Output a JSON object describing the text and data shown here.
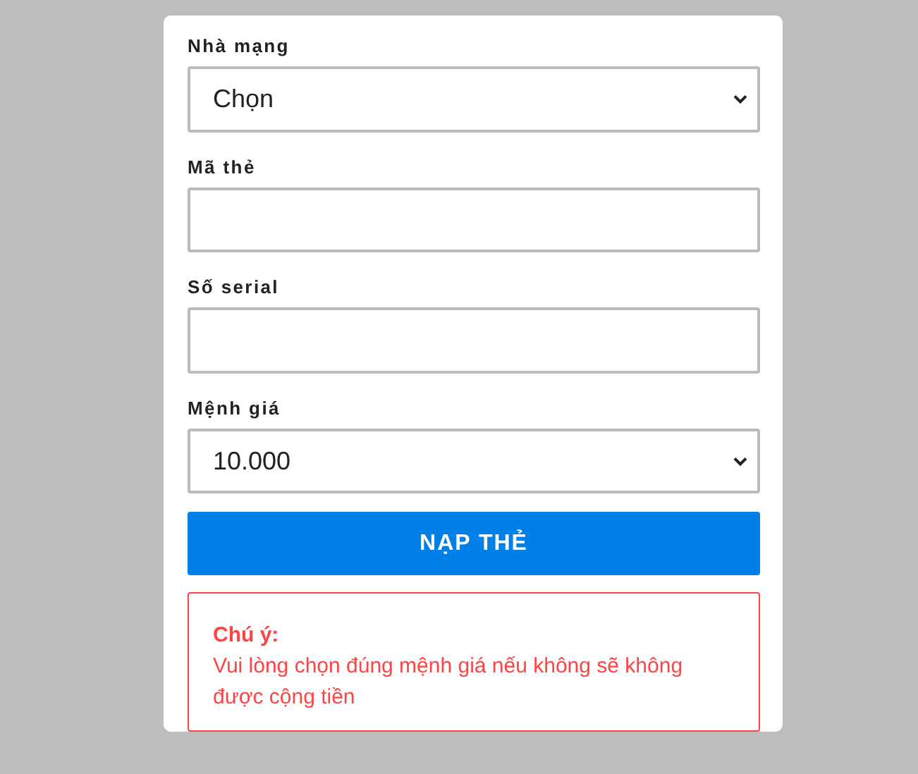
{
  "fields": [
    {
      "label": "Nhà mạng",
      "kind": "select",
      "value": "Chọn"
    },
    {
      "label": "Mã thẻ",
      "kind": "text"
    },
    {
      "label": "Số serial",
      "kind": "text"
    },
    {
      "label": "Mệnh giá",
      "kind": "select",
      "value": "10.000"
    }
  ],
  "submit_button": "NẠP THẺ",
  "notice": {
    "title": "Chú ý:",
    "text": "Vui lòng chọn đúng mệnh giá nếu không sẽ không được cộng tiền"
  }
}
